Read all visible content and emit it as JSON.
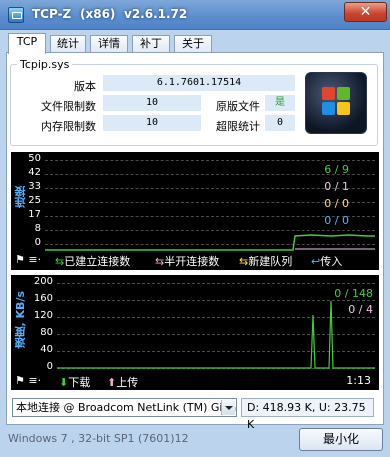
{
  "window": {
    "title": "TCP-Z",
    "arch": "(x86)",
    "version": "v2.6.1.72",
    "close_label": "✕"
  },
  "tabs": [
    {
      "label": "TCP"
    },
    {
      "label": "统计"
    },
    {
      "label": "详情"
    },
    {
      "label": "补丁"
    },
    {
      "label": "关于"
    }
  ],
  "info": {
    "group_title": "Tcpip.sys",
    "version_label": "版本",
    "version_value": "6.1.7601.17514",
    "file_limit_label": "文件限制数",
    "file_limit_value": "10",
    "original_file_label": "原版文件",
    "original_file_value": "是",
    "mem_limit_label": "内存限制数",
    "mem_limit_value": "10",
    "overlimit_label": "超限统计",
    "overlimit_value": "0"
  },
  "connections_graph": {
    "title": "连接",
    "y_ticks": [
      "50",
      "42",
      "33",
      "25",
      "17",
      "8",
      "0"
    ],
    "stats": [
      {
        "text": "6 / 9",
        "color": "#3ccf3c"
      },
      {
        "text": "0 / 1",
        "color": "#e8c8e8"
      },
      {
        "text": "0 / 0",
        "color": "#ffe14a"
      },
      {
        "text": "0 / 0",
        "color": "#47b8ff"
      }
    ],
    "legend": [
      {
        "icon": "⇆",
        "label": "已建立连接数",
        "color": "#3ccf3c"
      },
      {
        "icon": "⇆",
        "label": "半开连接数",
        "color": "#f0a8c8"
      },
      {
        "icon": "⇆",
        "label": "新建队列",
        "color": "#ffe14a"
      },
      {
        "icon": "↩",
        "label": "传入",
        "color": "#47b8ff"
      }
    ],
    "line_color": "#3ccf3c",
    "chart_data": {
      "type": "line",
      "y_range": [
        0,
        50
      ],
      "established_recent": 6
    }
  },
  "speed_graph": {
    "title": "速度, KB/s",
    "y_ticks": [
      "200",
      "160",
      "120",
      "80",
      "40",
      "0"
    ],
    "stats": [
      {
        "text": "0 / 148",
        "color": "#3ccf3c"
      },
      {
        "text": "0 / 4",
        "color": "#e8c8e8"
      }
    ],
    "legend": [
      {
        "icon": "⬇",
        "label": "下载",
        "color": "#3ccf3c"
      },
      {
        "icon": "⬆",
        "label": "上传",
        "color": "#f0a8c8"
      }
    ],
    "time": "1:13",
    "chart_data": {
      "type": "line",
      "y_range": [
        0,
        200
      ],
      "spikes": [
        130,
        148
      ]
    }
  },
  "adapter": {
    "selected": "本地连接 @ Broadcom NetLink (TM) Gigal"
  },
  "rate": {
    "text": "D:  418.93 K, U:   23.75 K"
  },
  "footer": {
    "os_text": "Windows 7 , 32-bit SP1 (7601)12",
    "minimize_label": "最小化"
  }
}
